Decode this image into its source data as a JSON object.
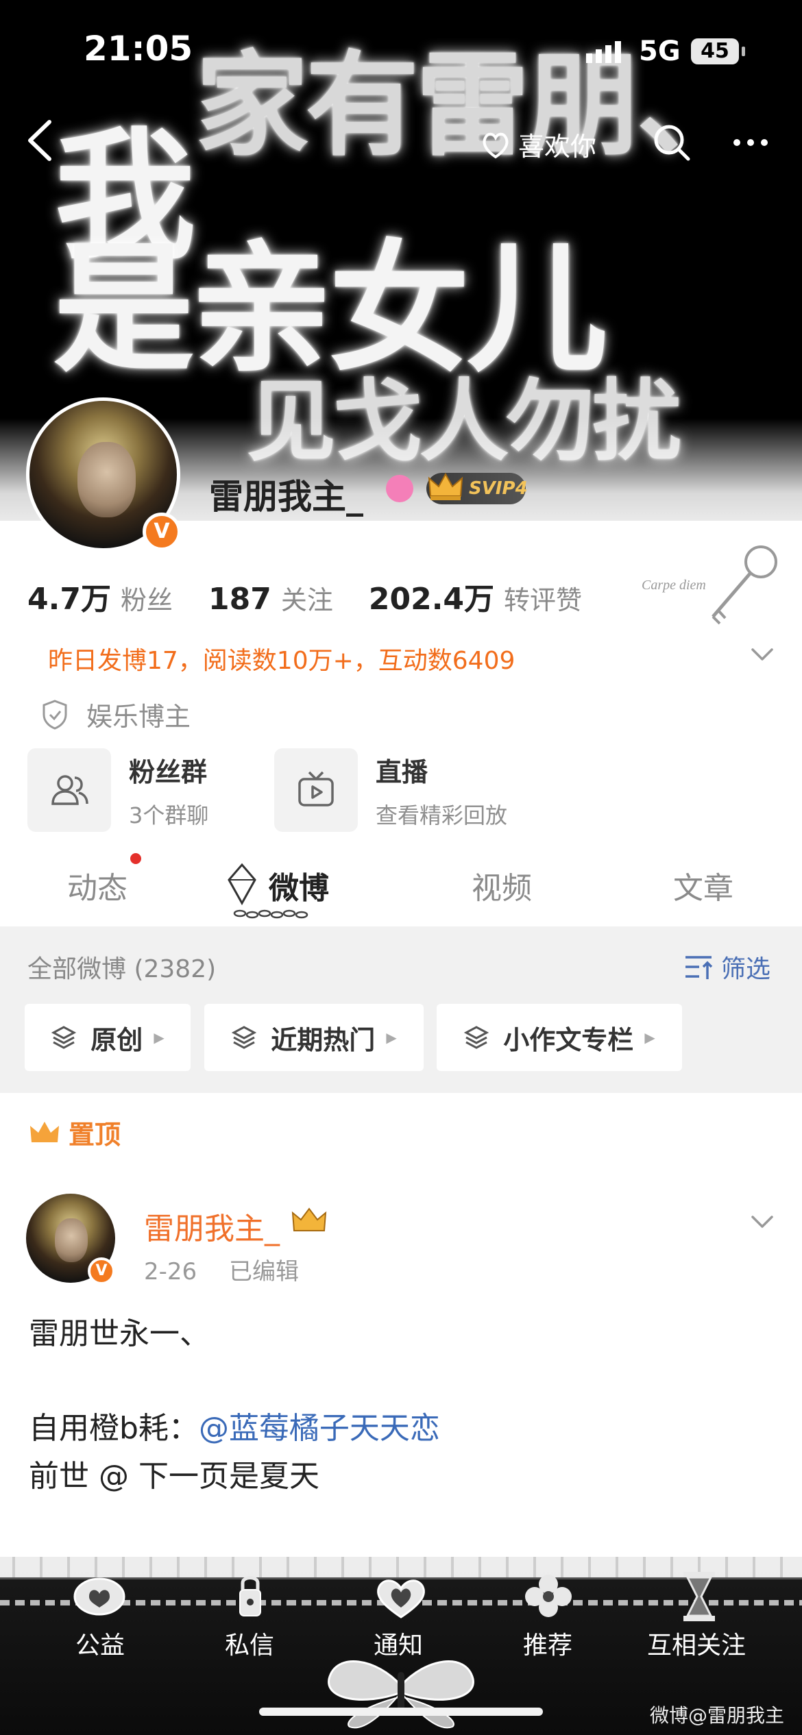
{
  "status_bar": {
    "time": "21:05",
    "network": "5G",
    "battery": "45"
  },
  "banner": {
    "line1": "家有雷朋、",
    "line2": "我",
    "line3": "是亲女儿",
    "line4": "见戈人勿扰"
  },
  "nav": {
    "like_label": "喜欢你"
  },
  "profile": {
    "username": "雷朋我主_",
    "vip_badge": "SVIP4",
    "stats": [
      {
        "value": "4.7万",
        "label": "粉丝"
      },
      {
        "value": "187",
        "label": "关注"
      },
      {
        "value": "202.4万",
        "label": "转评赞"
      }
    ],
    "summary": "昨日发博17，阅读数10万+，互动数6409",
    "role": "娱乐博主",
    "cards": [
      {
        "title": "粉丝群",
        "subtitle": "3个群聊"
      },
      {
        "title": "直播",
        "subtitle": "查看精彩回放"
      }
    ],
    "key_caption": "Carpe diem"
  },
  "tabs": [
    {
      "label": "动态"
    },
    {
      "label": "微博"
    },
    {
      "label": "视频"
    },
    {
      "label": "文章"
    }
  ],
  "feed": {
    "all_label": "全部微博 (2382)",
    "filter_label": "筛选",
    "chips": [
      "原创",
      "近期热门",
      "小作文专栏"
    ]
  },
  "pinned": {
    "label": "置顶",
    "author": "雷朋我主_",
    "date": "2-26",
    "edited": "已编辑",
    "line1": "雷朋世永一、",
    "line2_prefix": "自用橙b耗：",
    "line2_mention": "@蓝莓橘子天天恋",
    "line3": "前世 @ 下一页是夏天"
  },
  "bottom_tabs": [
    "公益",
    "私信",
    "通知",
    "推荐",
    "互相关注"
  ],
  "watermark": "微博@雷朋我主",
  "colors": {
    "accent_orange": "#f26d1b",
    "link_blue": "#3a6ab8",
    "vip_gold": "#f3c35a"
  }
}
